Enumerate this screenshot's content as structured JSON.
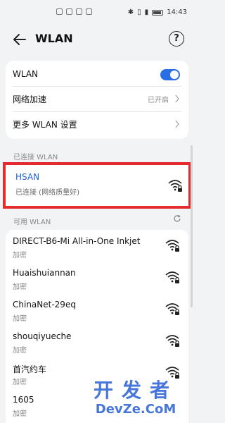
{
  "status_bar": {
    "time": "14:43"
  },
  "header": {
    "title": "WLAN",
    "help_symbol": "?"
  },
  "settings": {
    "wlan_label": "WLAN",
    "wlan_enabled": true,
    "accel_label": "网络加速",
    "accel_value": "已开启",
    "more_label": "更多 WLAN 设置"
  },
  "connected_section": "已连接 WLAN",
  "connected": {
    "ssid": "HSAN",
    "state": "已连接 (网络质量好)"
  },
  "available_section": "可用 WLAN",
  "networks": [
    {
      "ssid": "DIRECT-B6-Mi All-in-One Inkjet",
      "security": "加密"
    },
    {
      "ssid": "Huaishuiannan",
      "security": "加密"
    },
    {
      "ssid": "ChinaNet-29eq",
      "security": "加密"
    },
    {
      "ssid": "shouqiyueche",
      "security": "加密"
    },
    {
      "ssid": "首汽约车",
      "security": "加密"
    },
    {
      "ssid": "1605",
      "security": "加密"
    }
  ],
  "watermark": {
    "top": "开发者",
    "bottom": "DevZe.CoM"
  },
  "colors": {
    "accent": "#2a6ee6",
    "highlight_border": "#e52b2b",
    "connected_ssid": "#1f62d3"
  }
}
